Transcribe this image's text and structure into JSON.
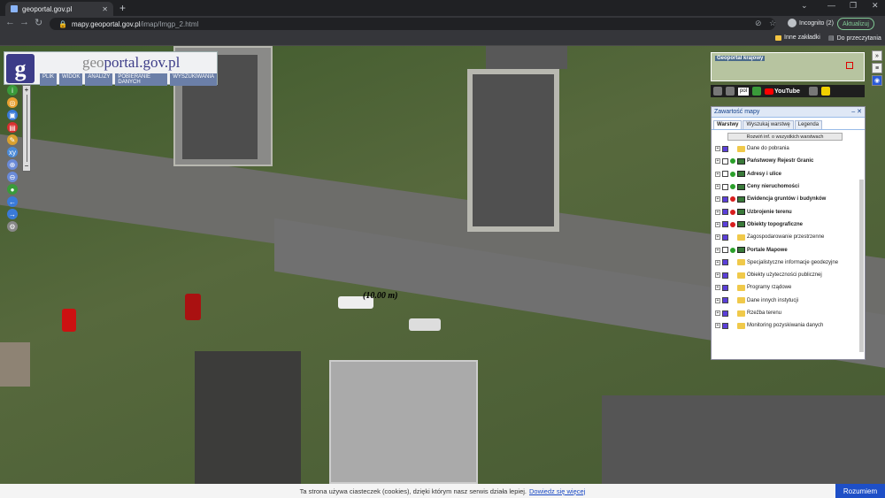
{
  "browser": {
    "tab_title": "geoportal.gov.pl",
    "url_host": "mapy.geoportal.gov.pl",
    "url_path": "/imap/Imgp_2.html",
    "incognito_label": "Incognito (2)",
    "update_label": "Aktualizuj",
    "bookmarks": {
      "other": "Inne zakładki",
      "reading": "Do przeczytania"
    }
  },
  "app": {
    "logo_letter": "g",
    "brand_prefix": "geo",
    "brand_rest": "portal.gov.pl",
    "menu": [
      "PLIK",
      "WIDOK",
      "ANALIZY",
      "POBIERANIE DANYCH",
      "WYSZUKIWANIA"
    ],
    "zoom_in": "+",
    "zoom_out": "−",
    "minimap_label": "Geoportal krajowy",
    "scale_label": "(10.00 m)",
    "language_value": "pol",
    "youtube_label": "YouTube"
  },
  "panel": {
    "title": "Zawartość mapy",
    "tabs": [
      "Warstwy",
      "Wyszukaj warstwę",
      "Legenda"
    ],
    "expand_button": "Rozwiń inf. o wszystkich warstwach",
    "layers": [
      {
        "label": "Dane do pobrania",
        "checked": true,
        "bold": false,
        "status": "none",
        "icon": "folder"
      },
      {
        "label": "Państwowy Rejestr Granic",
        "checked": false,
        "bold": true,
        "status": "green",
        "icon": "legend"
      },
      {
        "label": "Adresy i ulice",
        "checked": false,
        "bold": true,
        "status": "green",
        "icon": "legend"
      },
      {
        "label": "Ceny nieruchomości",
        "checked": false,
        "bold": true,
        "status": "green",
        "icon": "legend"
      },
      {
        "label": "Ewidencja gruntów i budynków",
        "checked": true,
        "bold": true,
        "status": "red",
        "icon": "legend"
      },
      {
        "label": "Uzbrojenie terenu",
        "checked": true,
        "bold": true,
        "status": "red",
        "icon": "legend"
      },
      {
        "label": "Obiekty topograficzne",
        "checked": true,
        "bold": true,
        "status": "red",
        "icon": "legend"
      },
      {
        "label": "Zagospodarowanie przestrzenne",
        "checked": true,
        "bold": false,
        "status": "none",
        "icon": "folder"
      },
      {
        "label": "Portale Mapowe",
        "checked": false,
        "bold": true,
        "status": "green",
        "icon": "legend"
      },
      {
        "label": "Specjalistyczne informacje geodezyjne",
        "checked": true,
        "bold": false,
        "status": "none",
        "icon": "folder"
      },
      {
        "label": "Obiekty użyteczności publicznej",
        "checked": true,
        "bold": false,
        "status": "none",
        "icon": "folder"
      },
      {
        "label": "Programy rządowe",
        "checked": true,
        "bold": false,
        "status": "none",
        "icon": "folder"
      },
      {
        "label": "Dane innych instytucji",
        "checked": true,
        "bold": false,
        "status": "none",
        "icon": "folder"
      },
      {
        "label": "Rzeźba terenu",
        "checked": true,
        "bold": false,
        "status": "none",
        "icon": "folder"
      },
      {
        "label": "Monitoring pozyskiwania danych",
        "checked": true,
        "bold": false,
        "status": "none",
        "icon": "folder"
      }
    ]
  },
  "cookie": {
    "text": "Ta strona używa ciasteczek (cookies), dzięki którym nasz serwis działa lepiej.",
    "link": "Dowiedz się więcej",
    "button": "Rozumiem"
  },
  "colors": {
    "brand_blue": "#3c3c88",
    "cookie_button": "#1e4fc7",
    "checkbox": "#5b3fd9"
  }
}
